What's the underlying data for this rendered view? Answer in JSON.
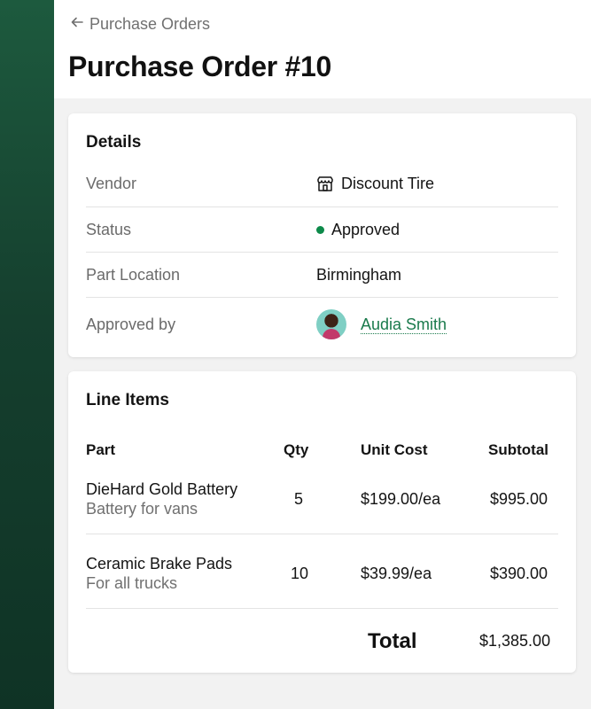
{
  "header": {
    "back_label": "Purchase Orders",
    "title": "Purchase Order #10"
  },
  "details": {
    "title": "Details",
    "vendor": {
      "label": "Vendor",
      "value": "Discount Tire",
      "icon": "store-icon"
    },
    "status": {
      "label": "Status",
      "value": "Approved",
      "color": "#0d8a4a"
    },
    "location": {
      "label": "Part Location",
      "value": "Birmingham"
    },
    "approved_by": {
      "label": "Approved by",
      "value": "Audia Smith"
    }
  },
  "line_items": {
    "title": "Line Items",
    "columns": {
      "part": "Part",
      "qty": "Qty",
      "unit_cost": "Unit Cost",
      "subtotal": "Subtotal"
    },
    "rows": [
      {
        "name": "DieHard Gold Battery",
        "description": "Battery for vans",
        "qty": "5",
        "unit_cost": "$199.00/ea",
        "subtotal": "$995.00"
      },
      {
        "name": "Ceramic Brake Pads",
        "description": "For all trucks",
        "qty": "10",
        "unit_cost": "$39.99/ea",
        "subtotal": "$390.00"
      }
    ],
    "total_label": "Total",
    "total_value": "$1,385.00"
  },
  "colors": {
    "sidebar": "#1d5a3e",
    "accent": "#1a7a4c"
  }
}
